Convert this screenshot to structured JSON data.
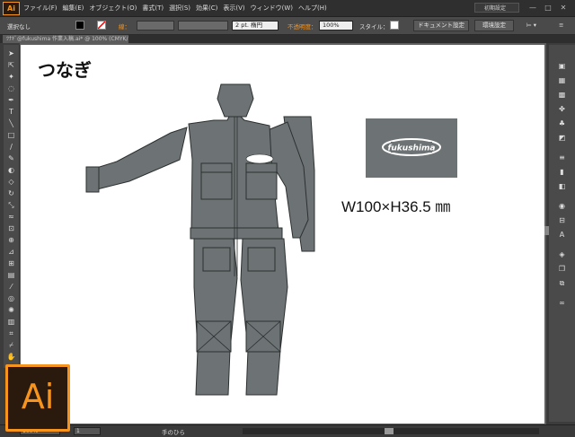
{
  "app": {
    "logo": "Ai"
  },
  "menu": [
    "ファイル(F)",
    "編集(E)",
    "オブジェクト(O)",
    "書式(T)",
    "選択(S)",
    "効果(C)",
    "表示(V)",
    "ウィンドウ(W)",
    "ヘルプ(H)"
  ],
  "workspace": {
    "label": "初期設定"
  },
  "window_controls": {
    "minimize": "—",
    "maximize": "□",
    "close": "✕"
  },
  "control_bar": {
    "selection_label": "選択なし",
    "stroke_label": "線：",
    "stroke_weight": "2 pt. 楕円",
    "opacity_label": "不透明度：",
    "opacity_value": "100%",
    "style_label": "スタイル：",
    "doc_setup_button": "ドキュメント設定",
    "prefs_button": "環境設定"
  },
  "document_tab": {
    "label": "ﾂﾅｷﾞ@fukushima 作業入稿.ai* @ 100% (CMYK/プレビュー)"
  },
  "artboard": {
    "title": "つなぎ",
    "logo_text": "fukushima",
    "dimensions": "W100×H36.5 ㎜"
  },
  "status": {
    "zoom": "100%",
    "page": "1",
    "tool": "手のひら"
  },
  "colors": {
    "accent": "#f7941d",
    "garment": "#6d7374",
    "garment_stroke": "#2b2f30"
  },
  "icons": [
    "selection-tool-icon",
    "direct-selection-tool-icon",
    "magic-wand-icon",
    "lasso-icon",
    "pen-tool-icon",
    "type-tool-icon",
    "line-tool-icon",
    "rectangle-tool-icon",
    "brush-icon",
    "pencil-icon",
    "blob-brush-icon",
    "eraser-icon",
    "rotate-icon",
    "scale-icon",
    "warp-icon",
    "free-transform-icon",
    "shape-builder-icon",
    "perspective-grid-icon",
    "mesh-icon",
    "gradient-icon",
    "eyedropper-icon",
    "blend-icon",
    "symbol-sprayer-icon",
    "graph-icon",
    "artboard-tool-icon",
    "slice-icon",
    "hand-icon",
    "zoom-icon"
  ]
}
